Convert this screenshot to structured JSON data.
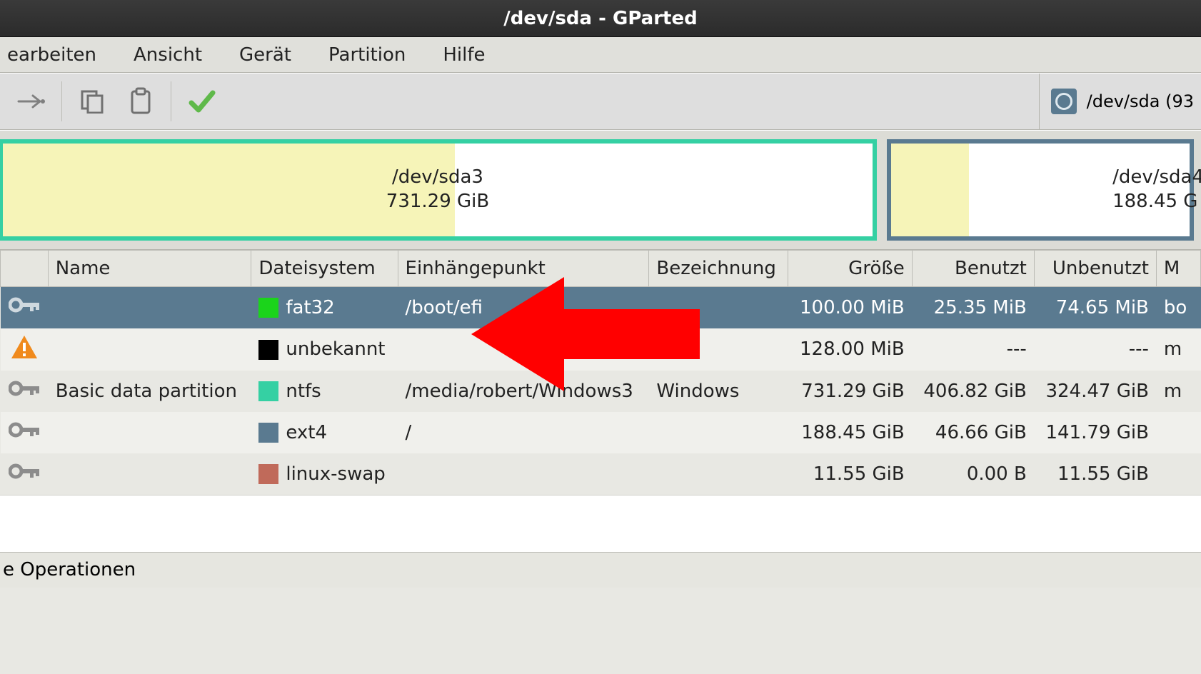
{
  "window": {
    "title": "/dev/sda - GParted"
  },
  "menu": {
    "edit": "earbeiten",
    "view": "Ansicht",
    "device": "Gerät",
    "partition": "Partition",
    "help": "Hilfe"
  },
  "toolbar": {
    "device_selector": "/dev/sda  (93"
  },
  "map": {
    "sda3": {
      "name": "/dev/sda3",
      "size": "731.29 GiB"
    },
    "sda4": {
      "name": "/dev/sda4",
      "size": "188.45 G"
    }
  },
  "columns": {
    "name": "Name",
    "filesystem": "Dateisystem",
    "mountpoint": "Einhängepunkt",
    "label": "Bezeichnung",
    "size": "Größe",
    "used": "Benutzt",
    "unused": "Unbenutzt",
    "flags": "M"
  },
  "partitions": [
    {
      "status": "key",
      "name": "",
      "fs": "fat32",
      "fs_color": "c-fat32",
      "mount": "/boot/efi",
      "label": "",
      "size": "100.00 MiB",
      "used": "25.35 MiB",
      "unused": "74.65 MiB",
      "flags": "bo",
      "selected": true
    },
    {
      "status": "warn",
      "name": "",
      "fs": "unbekannt",
      "fs_color": "c-unknown",
      "mount": "",
      "label": "",
      "size": "128.00 MiB",
      "used": "---",
      "unused": "---",
      "flags": "m",
      "alt": true
    },
    {
      "status": "key",
      "name": "Basic data partition",
      "fs": "ntfs",
      "fs_color": "c-ntfs",
      "mount": "/media/robert/Windows3",
      "label": "Windows",
      "size": "731.29 GiB",
      "used": "406.82 GiB",
      "unused": "324.47 GiB",
      "flags": "m"
    },
    {
      "status": "key",
      "name": "",
      "fs": "ext4",
      "fs_color": "c-ext4",
      "mount": "/",
      "label": "",
      "size": "188.45 GiB",
      "used": "46.66 GiB",
      "unused": "141.79 GiB",
      "flags": "",
      "alt": true
    },
    {
      "status": "key",
      "name": "",
      "fs": "linux-swap",
      "fs_color": "c-swap",
      "mount": "",
      "label": "",
      "size": "11.55 GiB",
      "used": "0.00 B",
      "unused": "11.55 GiB",
      "flags": ""
    }
  ],
  "statusbar": {
    "pending": "e Operationen"
  }
}
